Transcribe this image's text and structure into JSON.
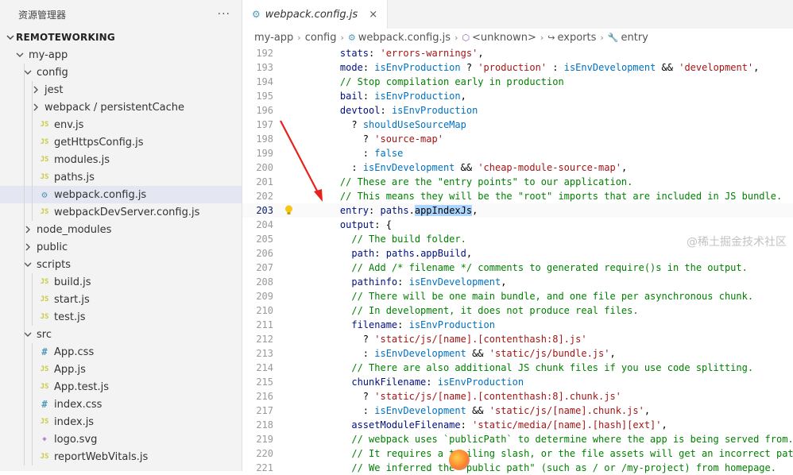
{
  "sidebar": {
    "title": "资源管理器",
    "more": "···",
    "root": "REMOTEWORKING",
    "tree": [
      {
        "label": "my-app",
        "type": "folder",
        "open": true,
        "depth": 1
      },
      {
        "label": "config",
        "type": "folder",
        "open": true,
        "depth": 2
      },
      {
        "label": "jest",
        "type": "folder",
        "open": false,
        "depth": 3
      },
      {
        "label": "webpack / persistentCache",
        "type": "folder",
        "open": false,
        "depth": 3
      },
      {
        "label": "env.js",
        "type": "js",
        "depth": 3
      },
      {
        "label": "getHttpsConfig.js",
        "type": "js",
        "depth": 3
      },
      {
        "label": "modules.js",
        "type": "js",
        "depth": 3
      },
      {
        "label": "paths.js",
        "type": "js",
        "depth": 3
      },
      {
        "label": "webpack.config.js",
        "type": "web",
        "depth": 3,
        "selected": true
      },
      {
        "label": "webpackDevServer.config.js",
        "type": "js",
        "depth": 3
      },
      {
        "label": "node_modules",
        "type": "folder",
        "open": false,
        "depth": 2
      },
      {
        "label": "public",
        "type": "folder",
        "open": false,
        "depth": 2
      },
      {
        "label": "scripts",
        "type": "folder",
        "open": true,
        "depth": 2
      },
      {
        "label": "build.js",
        "type": "js",
        "depth": 3
      },
      {
        "label": "start.js",
        "type": "js",
        "depth": 3
      },
      {
        "label": "test.js",
        "type": "js",
        "depth": 3
      },
      {
        "label": "src",
        "type": "folder",
        "open": true,
        "depth": 2
      },
      {
        "label": "App.css",
        "type": "css",
        "depth": 3
      },
      {
        "label": "App.js",
        "type": "js",
        "depth": 3
      },
      {
        "label": "App.test.js",
        "type": "js",
        "depth": 3
      },
      {
        "label": "index.css",
        "type": "css",
        "depth": 3
      },
      {
        "label": "index.js",
        "type": "js",
        "depth": 3
      },
      {
        "label": "logo.svg",
        "type": "svg",
        "depth": 3
      },
      {
        "label": "reportWebVitals.js",
        "type": "js",
        "depth": 3
      }
    ]
  },
  "tab": {
    "label": "webpack.config.js",
    "close": "×"
  },
  "breadcrumb": [
    "my-app",
    "config",
    "webpack.config.js",
    "<unknown>",
    "exports",
    "entry"
  ],
  "code": {
    "current_line": 203,
    "lines": [
      {
        "n": 192,
        "indent": 4,
        "t": [
          [
            "k",
            "stats"
          ],
          [
            "p",
            ": "
          ],
          [
            "s",
            "'errors-warnings'"
          ],
          [
            "p",
            ","
          ]
        ]
      },
      {
        "n": 193,
        "indent": 4,
        "t": [
          [
            "k",
            "mode"
          ],
          [
            "p",
            ": "
          ],
          [
            "v",
            "isEnvProduction"
          ],
          [
            "p",
            " ? "
          ],
          [
            "s",
            "'production'"
          ],
          [
            "p",
            " : "
          ],
          [
            "v",
            "isEnvDevelopment"
          ],
          [
            "p",
            " && "
          ],
          [
            "s",
            "'development'"
          ],
          [
            "p",
            ","
          ]
        ]
      },
      {
        "n": 194,
        "indent": 4,
        "t": [
          [
            "c",
            "// Stop compilation early in production"
          ]
        ]
      },
      {
        "n": 195,
        "indent": 4,
        "t": [
          [
            "k",
            "bail"
          ],
          [
            "p",
            ": "
          ],
          [
            "v",
            "isEnvProduction"
          ],
          [
            "p",
            ","
          ]
        ]
      },
      {
        "n": 196,
        "indent": 4,
        "t": [
          [
            "k",
            "devtool"
          ],
          [
            "p",
            ": "
          ],
          [
            "v",
            "isEnvProduction"
          ]
        ]
      },
      {
        "n": 197,
        "indent": 6,
        "t": [
          [
            "p",
            "? "
          ],
          [
            "v",
            "shouldUseSourceMap"
          ]
        ]
      },
      {
        "n": 198,
        "indent": 8,
        "t": [
          [
            "p",
            "? "
          ],
          [
            "s",
            "'source-map'"
          ]
        ]
      },
      {
        "n": 199,
        "indent": 8,
        "t": [
          [
            "p",
            ": "
          ],
          [
            "v",
            "false"
          ]
        ]
      },
      {
        "n": 200,
        "indent": 6,
        "t": [
          [
            "p",
            ": "
          ],
          [
            "v",
            "isEnvDevelopment"
          ],
          [
            "p",
            " && "
          ],
          [
            "s",
            "'cheap-module-source-map'"
          ],
          [
            "p",
            ","
          ]
        ]
      },
      {
        "n": 201,
        "indent": 4,
        "t": [
          [
            "c",
            "// These are the \"entry points\" to our application."
          ]
        ]
      },
      {
        "n": 202,
        "indent": 4,
        "t": [
          [
            "c",
            "// This means they will be the \"root\" imports that are included in JS bundle."
          ]
        ]
      },
      {
        "n": 203,
        "indent": 4,
        "t": [
          [
            "k",
            "entry"
          ],
          [
            "p",
            ": "
          ],
          [
            "k",
            "paths"
          ],
          [
            "p",
            "."
          ],
          [
            "hl",
            "appIndexJs"
          ],
          [
            "p",
            ","
          ]
        ]
      },
      {
        "n": 204,
        "indent": 4,
        "t": [
          [
            "k",
            "output"
          ],
          [
            "p",
            ": {"
          ]
        ]
      },
      {
        "n": 205,
        "indent": 6,
        "t": [
          [
            "c",
            "// The build folder."
          ]
        ]
      },
      {
        "n": 206,
        "indent": 6,
        "t": [
          [
            "k",
            "path"
          ],
          [
            "p",
            ": "
          ],
          [
            "k",
            "paths"
          ],
          [
            "p",
            "."
          ],
          [
            "k",
            "appBuild"
          ],
          [
            "p",
            ","
          ]
        ]
      },
      {
        "n": 207,
        "indent": 6,
        "t": [
          [
            "c",
            "// Add /* filename */ comments to generated require()s in the output."
          ]
        ]
      },
      {
        "n": 208,
        "indent": 6,
        "t": [
          [
            "k",
            "pathinfo"
          ],
          [
            "p",
            ": "
          ],
          [
            "v",
            "isEnvDevelopment"
          ],
          [
            "p",
            ","
          ]
        ]
      },
      {
        "n": 209,
        "indent": 6,
        "t": [
          [
            "c",
            "// There will be one main bundle, and one file per asynchronous chunk."
          ]
        ]
      },
      {
        "n": 210,
        "indent": 6,
        "t": [
          [
            "c",
            "// In development, it does not produce real files."
          ]
        ]
      },
      {
        "n": 211,
        "indent": 6,
        "t": [
          [
            "k",
            "filename"
          ],
          [
            "p",
            ": "
          ],
          [
            "v",
            "isEnvProduction"
          ]
        ]
      },
      {
        "n": 212,
        "indent": 8,
        "t": [
          [
            "p",
            "? "
          ],
          [
            "s",
            "'static/js/[name].[contenthash:8].js'"
          ]
        ]
      },
      {
        "n": 213,
        "indent": 8,
        "t": [
          [
            "p",
            ": "
          ],
          [
            "v",
            "isEnvDevelopment"
          ],
          [
            "p",
            " && "
          ],
          [
            "s",
            "'static/js/bundle.js'"
          ],
          [
            "p",
            ","
          ]
        ]
      },
      {
        "n": 214,
        "indent": 6,
        "t": [
          [
            "c",
            "// There are also additional JS chunk files if you use code splitting."
          ]
        ]
      },
      {
        "n": 215,
        "indent": 6,
        "t": [
          [
            "k",
            "chunkFilename"
          ],
          [
            "p",
            ": "
          ],
          [
            "v",
            "isEnvProduction"
          ]
        ]
      },
      {
        "n": 216,
        "indent": 8,
        "t": [
          [
            "p",
            "? "
          ],
          [
            "s",
            "'static/js/[name].[contenthash:8].chunk.js'"
          ]
        ]
      },
      {
        "n": 217,
        "indent": 8,
        "t": [
          [
            "p",
            ": "
          ],
          [
            "v",
            "isEnvDevelopment"
          ],
          [
            "p",
            " && "
          ],
          [
            "s",
            "'static/js/[name].chunk.js'"
          ],
          [
            "p",
            ","
          ]
        ]
      },
      {
        "n": 218,
        "indent": 6,
        "t": [
          [
            "k",
            "assetModuleFilename"
          ],
          [
            "p",
            ": "
          ],
          [
            "s",
            "'static/media/[name].[hash][ext]'"
          ],
          [
            "p",
            ","
          ]
        ]
      },
      {
        "n": 219,
        "indent": 6,
        "t": [
          [
            "c",
            "// webpack uses `publicPath` to determine where the app is being served from."
          ]
        ]
      },
      {
        "n": 220,
        "indent": 6,
        "t": [
          [
            "c",
            "// It requires a trailing slash, or the file assets will get an incorrect path."
          ]
        ]
      },
      {
        "n": 221,
        "indent": 6,
        "t": [
          [
            "c",
            "// We inferred the \"public path\" (such as / or /my-project) from homepage."
          ]
        ]
      }
    ]
  },
  "watermark": "@稀土掘金技术社区",
  "colors": {
    "keyword": "#001080",
    "value": "#0070c1",
    "string": "#a31515",
    "comment": "#008000",
    "arrow": "#e8211c"
  }
}
